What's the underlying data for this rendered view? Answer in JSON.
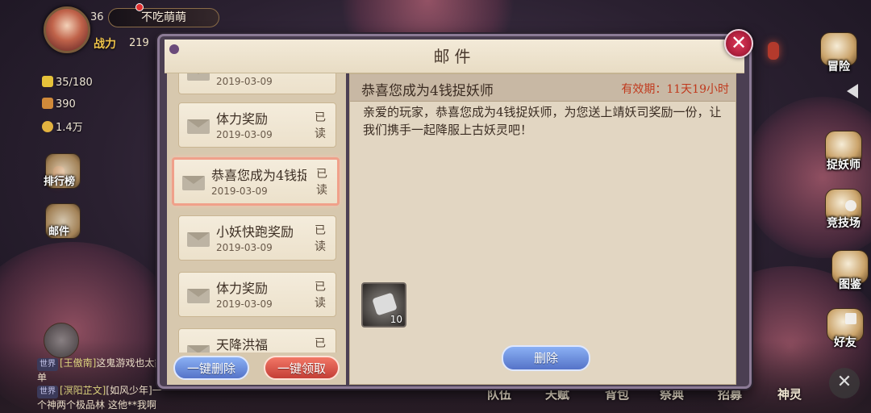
{
  "player": {
    "level": "36",
    "name": "不吃萌萌",
    "combat_label": "战力",
    "combat_value": "219",
    "resources": [
      "35/180",
      "390",
      "1.4万"
    ]
  },
  "left_icons": [
    "排行榜",
    "邮件"
  ],
  "right_menu": [
    "冒险",
    "捉妖师",
    "竞技场",
    "图鉴",
    "好友"
  ],
  "bottom_menu": [
    "队伍",
    "天赋",
    "背包",
    "祭典",
    "招募",
    "神灵"
  ],
  "chat": [
    {
      "tag": "世界",
      "user": "[王傲南]",
      "text": "这鬼游戏也太简单"
    },
    {
      "tag": "世界",
      "user": "[溟阳芷文]",
      "text": "[如风少年]一个神两个极品林 这他**我啊"
    }
  ],
  "mail": {
    "title": "邮件",
    "close_label": "✕",
    "items": [
      {
        "title": "",
        "date": "2019-03-09",
        "read": "读",
        "selected": false
      },
      {
        "title": "体力奖励",
        "date": "2019-03-09",
        "read": "已读",
        "selected": false
      },
      {
        "title": "恭喜您成为4钱捉妖师",
        "date": "2019-03-09",
        "read": "已读",
        "selected": true
      },
      {
        "title": "小妖快跑奖励",
        "date": "2019-03-09",
        "read": "已读",
        "selected": false
      },
      {
        "title": "体力奖励",
        "date": "2019-03-09",
        "read": "已读",
        "selected": false
      },
      {
        "title": "天降洪福",
        "date": "",
        "read": "已",
        "selected": false
      }
    ],
    "delete_all_label": "一键删除",
    "claim_all_label": "一键领取",
    "detail": {
      "title": "恭喜您成为4钱捉妖师",
      "expiry": "有效期：11天19小时",
      "body": "亲爱的玩家，恭喜您成为4钱捉妖师，为您送上靖妖司奖励一份，让我们携手一起降服上古妖灵吧！",
      "attachment_count": "10",
      "delete_label": "删除"
    }
  },
  "colors": {
    "panel_border": "#8c7b96",
    "parchment": "#e2d6c2",
    "expiry_red": "#c0391d",
    "selected_border": "#f0a08a"
  }
}
